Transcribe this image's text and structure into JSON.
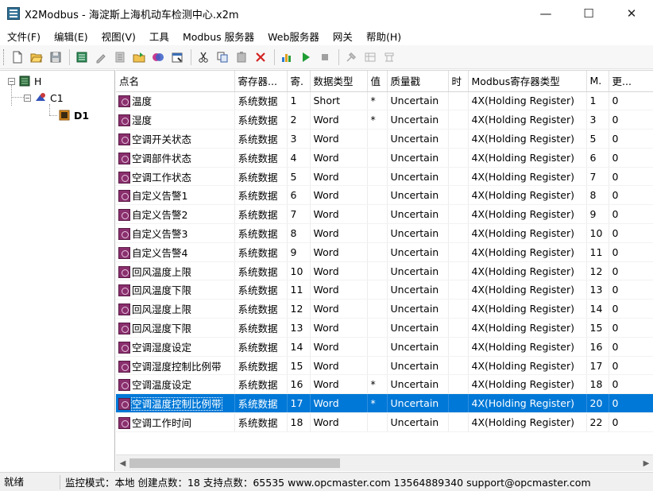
{
  "window": {
    "title": "X2Modbus - 海淀斯上海机动车检测中心.x2m",
    "minimize": "—",
    "maximize": "☐",
    "close": "✕"
  },
  "menu": [
    "文件(F)",
    "编辑(E)",
    "视图(V)",
    "工具",
    "Modbus 服务器",
    "Web服务器",
    "网关",
    "帮助(H)"
  ],
  "toolbar": {
    "icons": [
      "new-file-icon",
      "open-folder-icon",
      "save-icon",
      "add-channel-icon",
      "add-device-icon",
      "add-tag-icon",
      "open-tag-icon",
      "import-icon",
      "properties-icon",
      "cut-icon",
      "copy-icon",
      "paste-icon",
      "delete-icon",
      "monitor-icon",
      "run-icon",
      "stop-icon",
      "tool-icon",
      "web-icon",
      "gateway-icon"
    ]
  },
  "tree": {
    "root": "H",
    "channel": "C1",
    "device": "D1"
  },
  "table": {
    "columns": [
      "点名",
      "寄存器...",
      "寄.",
      "数据类型",
      "值",
      "质量戳",
      "时",
      "Modbus寄存器类型",
      "M.",
      "更..."
    ],
    "rows": [
      [
        "温度",
        "系统数据",
        "1",
        "Short",
        "*",
        "Uncertain",
        "",
        "4X(Holding Register)",
        "1",
        "0"
      ],
      [
        "湿度",
        "系统数据",
        "2",
        "Word",
        "*",
        "Uncertain",
        "",
        "4X(Holding Register)",
        "3",
        "0"
      ],
      [
        "空调开关状态",
        "系统数据",
        "3",
        "Word",
        "",
        "Uncertain",
        "",
        "4X(Holding Register)",
        "5",
        "0"
      ],
      [
        "空调部件状态",
        "系统数据",
        "4",
        "Word",
        "",
        "Uncertain",
        "",
        "4X(Holding Register)",
        "6",
        "0"
      ],
      [
        "空调工作状态",
        "系统数据",
        "5",
        "Word",
        "",
        "Uncertain",
        "",
        "4X(Holding Register)",
        "7",
        "0"
      ],
      [
        "自定义告警1",
        "系统数据",
        "6",
        "Word",
        "",
        "Uncertain",
        "",
        "4X(Holding Register)",
        "8",
        "0"
      ],
      [
        "自定义告警2",
        "系统数据",
        "7",
        "Word",
        "",
        "Uncertain",
        "",
        "4X(Holding Register)",
        "9",
        "0"
      ],
      [
        "自定义告警3",
        "系统数据",
        "8",
        "Word",
        "",
        "Uncertain",
        "",
        "4X(Holding Register)",
        "10",
        "0"
      ],
      [
        "自定义告警4",
        "系统数据",
        "9",
        "Word",
        "",
        "Uncertain",
        "",
        "4X(Holding Register)",
        "11",
        "0"
      ],
      [
        "回风温度上限",
        "系统数据",
        "10",
        "Word",
        "",
        "Uncertain",
        "",
        "4X(Holding Register)",
        "12",
        "0"
      ],
      [
        "回风温度下限",
        "系统数据",
        "11",
        "Word",
        "",
        "Uncertain",
        "",
        "4X(Holding Register)",
        "13",
        "0"
      ],
      [
        "回风湿度上限",
        "系统数据",
        "12",
        "Word",
        "",
        "Uncertain",
        "",
        "4X(Holding Register)",
        "14",
        "0"
      ],
      [
        "回风湿度下限",
        "系统数据",
        "13",
        "Word",
        "",
        "Uncertain",
        "",
        "4X(Holding Register)",
        "15",
        "0"
      ],
      [
        "空调湿度设定",
        "系统数据",
        "14",
        "Word",
        "",
        "Uncertain",
        "",
        "4X(Holding Register)",
        "16",
        "0"
      ],
      [
        "空调湿度控制比例带",
        "系统数据",
        "15",
        "Word",
        "",
        "Uncertain",
        "",
        "4X(Holding Register)",
        "17",
        "0"
      ],
      [
        "空调温度设定",
        "系统数据",
        "16",
        "Word",
        "*",
        "Uncertain",
        "",
        "4X(Holding Register)",
        "18",
        "0"
      ],
      [
        "空调温度控制比例带",
        "系统数据",
        "17",
        "Word",
        "*",
        "Uncertain",
        "",
        "4X(Holding Register)",
        "20",
        "0"
      ],
      [
        "空调工作时间",
        "系统数据",
        "18",
        "Word",
        "",
        "Uncertain",
        "",
        "4X(Holding Register)",
        "22",
        "0"
      ]
    ],
    "selected_row": 16
  },
  "status": {
    "ready": "就绪",
    "info": "监控模式：本地  创建点数：18  支持点数：65535  www.opcmaster.com 13564889340 support@opcmaster.com"
  }
}
